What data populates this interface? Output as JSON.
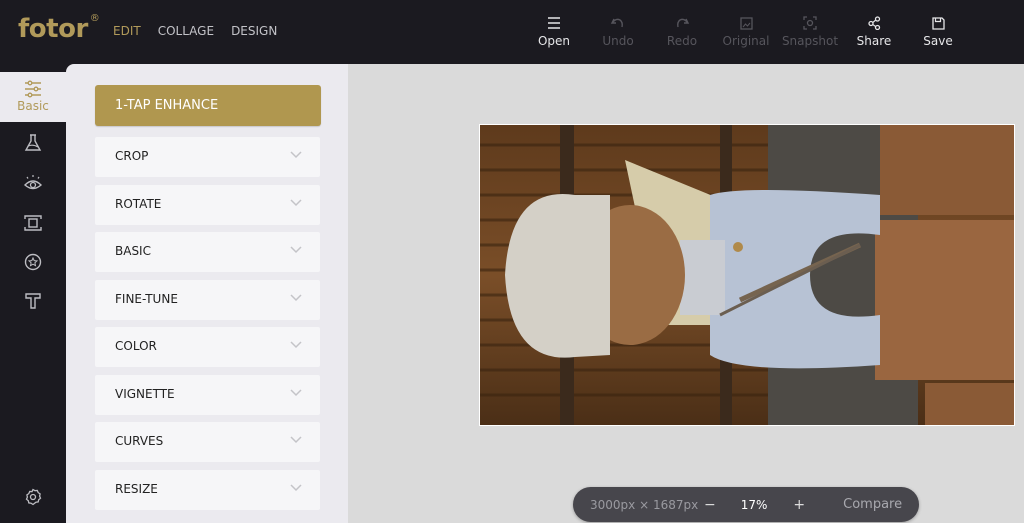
{
  "app": {
    "logo": "fotor",
    "logo_mark": "®"
  },
  "topnav": [
    {
      "label": "EDIT",
      "active": true
    },
    {
      "label": "COLLAGE",
      "active": false
    },
    {
      "label": "DESIGN",
      "active": false
    }
  ],
  "toolbar": [
    {
      "label": "Open",
      "icon": "menu-icon",
      "enabled": true
    },
    {
      "label": "Undo",
      "icon": "undo-icon",
      "enabled": false
    },
    {
      "label": "Redo",
      "icon": "redo-icon",
      "enabled": false
    },
    {
      "label": "Original",
      "icon": "image-icon",
      "enabled": false
    },
    {
      "label": "Snapshot",
      "icon": "snapshot-icon",
      "enabled": false
    },
    {
      "label": "Share",
      "icon": "share-icon",
      "enabled": true
    },
    {
      "label": "Save",
      "icon": "save-icon",
      "enabled": true
    }
  ],
  "sidebar": {
    "active_label": "Basic",
    "items": [
      {
        "name": "basic",
        "icon": "sliders-icon"
      },
      {
        "name": "effects",
        "icon": "flask-icon"
      },
      {
        "name": "beauty",
        "icon": "eye-icon"
      },
      {
        "name": "frames",
        "icon": "frame-icon"
      },
      {
        "name": "stickers",
        "icon": "star-badge-icon"
      },
      {
        "name": "text",
        "icon": "text-icon"
      },
      {
        "name": "settings",
        "icon": "gear-icon"
      }
    ]
  },
  "panel": {
    "enhance_label": "1-TAP ENHANCE",
    "sections": [
      "CROP",
      "ROTATE",
      "BASIC",
      "FINE-TUNE",
      "COLOR",
      "VIGNETTE",
      "CURVES",
      "RESIZE"
    ]
  },
  "statusbar": {
    "dimensions": "3000px × 1687px",
    "minus": "−",
    "zoom": "17%",
    "plus": "+",
    "compare": "Compare"
  },
  "colors": {
    "brand": "#b19a5a",
    "enhance_button": "#b0974f",
    "topbar": "#1b1a20"
  }
}
